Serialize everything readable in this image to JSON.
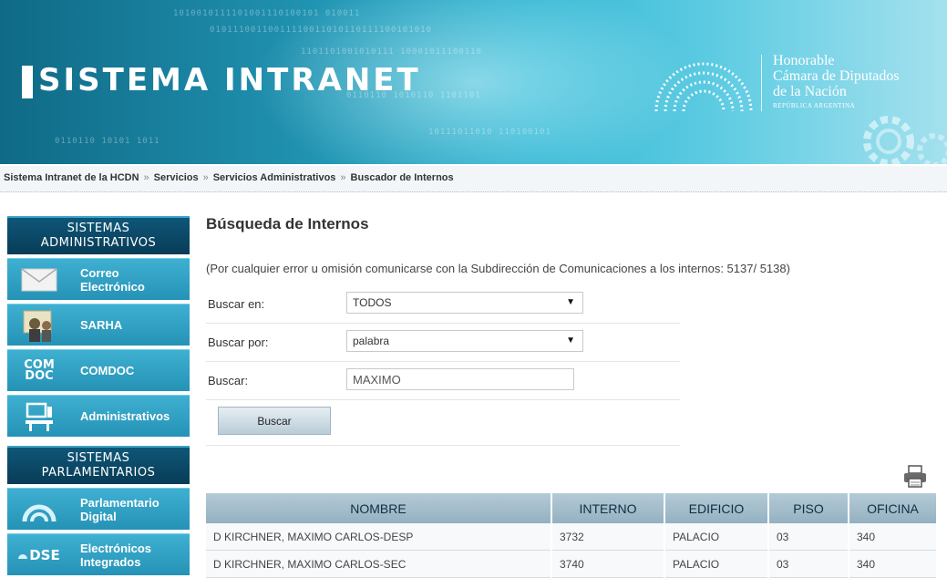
{
  "header": {
    "title": "SISTEMA INTRANET",
    "logo_lines": [
      "Honorable",
      "Cámara de Diputados",
      "de la Nación"
    ],
    "logo_sub": "REPÚBLICA ARGENTINA"
  },
  "breadcrumb": [
    "Sistema Intranet de la HCDN",
    "Servicios",
    "Servicios Administrativos",
    "Buscador de Internos"
  ],
  "breadcrumb_sep": "»",
  "sidebar": {
    "admin_heading": [
      "SISTEMAS",
      "ADMINISTRATIVOS"
    ],
    "admin_items": [
      {
        "label_lines": [
          "Correo",
          "Electrónico"
        ],
        "icon": "envelope-icon"
      },
      {
        "label_lines": [
          "SARHA"
        ],
        "icon": "people-icon"
      },
      {
        "label_lines": [
          "COMDOC"
        ],
        "icon": "comdoc-icon",
        "icon_text": [
          "COM",
          "DOC"
        ]
      },
      {
        "label_lines": [
          "Administrativos"
        ],
        "icon": "computer-icon"
      }
    ],
    "parl_heading": [
      "SISTEMAS",
      "PARLAMENTARIOS"
    ],
    "parl_items": [
      {
        "label_lines": [
          "Parlamentario",
          "Digital"
        ],
        "icon": "dome-icon"
      },
      {
        "label_lines": [
          "Electrónicos",
          "Integrados"
        ],
        "icon": "dse-icon",
        "icon_text": [
          "DSE"
        ]
      }
    ]
  },
  "main": {
    "title": "Búsqueda de Internos",
    "note": "(Por cualquier error u omisión comunicarse con la Subdirección de Comunicaciones a los internos: 5137/ 5138)",
    "form": {
      "buscar_en_label": "Buscar en:",
      "buscar_en_value": "TODOS",
      "buscar_por_label": "Buscar por:",
      "buscar_por_value": "palabra",
      "buscar_label": "Buscar:",
      "buscar_value": "MAXIMO",
      "submit_label": "Buscar"
    },
    "table": {
      "headers": [
        "NOMBRE",
        "INTERNO",
        "EDIFICIO",
        "PISO",
        "OFICINA"
      ],
      "rows": [
        [
          "D KIRCHNER, MAXIMO CARLOS-DESP",
          "3732",
          "PALACIO",
          "03",
          "340"
        ],
        [
          "D KIRCHNER, MAXIMO CARLOS-SEC",
          "3740",
          "PALACIO",
          "03",
          "340"
        ]
      ]
    }
  },
  "colors": {
    "banner": "#1f8fae",
    "sidebar_heading": "#0a4565",
    "sidebar_item": "#2f9fc3",
    "table_header": "#a3bdcb"
  }
}
